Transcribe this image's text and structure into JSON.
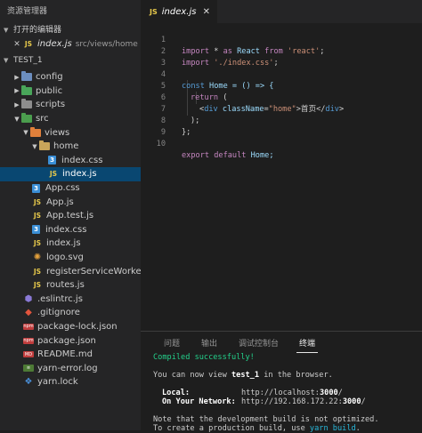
{
  "sidebar": {
    "title": "资源管理器",
    "open_editors_label": "打开的编辑器",
    "open_editor": {
      "name": "index.js",
      "path": "src/views/home"
    },
    "project_label": "TEST_1",
    "tree": [
      {
        "label": "config",
        "icon": "folder-config-icon"
      },
      {
        "label": "public",
        "icon": "folder-public-icon"
      },
      {
        "label": "scripts",
        "icon": "folder-scripts-icon"
      },
      {
        "label": "src",
        "icon": "folder-src-icon"
      },
      {
        "label": "views",
        "icon": "folder-views-icon"
      },
      {
        "label": "home",
        "icon": "folder-home-icon"
      },
      {
        "label": "index.css",
        "icon": "css-file-icon"
      },
      {
        "label": "index.js",
        "icon": "js-file-icon"
      },
      {
        "label": "App.css",
        "icon": "css-file-icon"
      },
      {
        "label": "App.js",
        "icon": "js-file-icon"
      },
      {
        "label": "App.test.js",
        "icon": "js-file-icon"
      },
      {
        "label": "index.css",
        "icon": "css-file-icon"
      },
      {
        "label": "index.js",
        "icon": "js-file-icon"
      },
      {
        "label": "logo.svg",
        "icon": "svg-file-icon"
      },
      {
        "label": "registerServiceWorker.js",
        "icon": "js-file-icon"
      },
      {
        "label": "routes.js",
        "icon": "js-file-icon"
      },
      {
        "label": ".eslintrc.js",
        "icon": "eslint-file-icon"
      },
      {
        "label": ".gitignore",
        "icon": "git-file-icon"
      },
      {
        "label": "package-lock.json",
        "icon": "json-file-icon"
      },
      {
        "label": "package.json",
        "icon": "json-file-icon"
      },
      {
        "label": "README.md",
        "icon": "markdown-file-icon"
      },
      {
        "label": "yarn-error.log",
        "icon": "log-file-icon"
      },
      {
        "label": "yarn.lock",
        "icon": "lock-file-icon"
      }
    ]
  },
  "editor": {
    "tab_label": "index.js",
    "file_badge": "JS",
    "line_numbers": [
      "1",
      "2",
      "3",
      "4",
      "5",
      "6",
      "7",
      "8",
      "9",
      "10"
    ],
    "code": {
      "l1": [
        "import",
        " * ",
        "as",
        " React ",
        "from",
        " 'react'",
        ";"
      ],
      "l2": [
        "import",
        " './index.css'",
        ";"
      ],
      "l4": [
        "const",
        " Home = () => {"
      ],
      "l5": [
        "return",
        " ("
      ],
      "l6": [
        "<",
        "div",
        " className",
        "=",
        "\"home\"",
        ">首页</",
        "div",
        ">"
      ],
      "l7": [
        ");"
      ],
      "l8": [
        "};"
      ],
      "l10": [
        "export",
        " default",
        " Home;"
      ]
    }
  },
  "panel": {
    "tabs": [
      "问题",
      "输出",
      "调试控制台",
      "终端"
    ],
    "active_tab": "终端",
    "terminal": {
      "compiled": "Compiled successfully!",
      "view_prefix": "You can now view ",
      "app_name": "test_1",
      "view_suffix": " in the browser.",
      "local_label": "Local:",
      "local_url_prefix": "http://localhost:",
      "local_port": "3000",
      "local_url_suffix": "/",
      "network_label": "On Your Network:",
      "network_url_prefix": "http://192.168.172.22:",
      "network_port": "3000",
      "network_url_suffix": "/",
      "note": "Note that the development build is not optimized.",
      "build_prefix": "To create a production build, use ",
      "build_cmd": "yarn build",
      "build_suffix": "."
    }
  }
}
